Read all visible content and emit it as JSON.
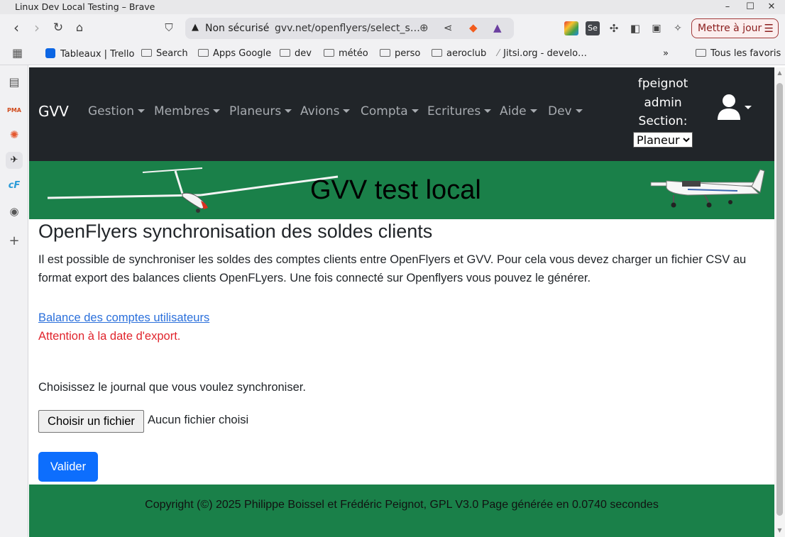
{
  "window": {
    "title": "Linux Dev Local Testing – Brave"
  },
  "browser": {
    "security_label": "Non sécurisé",
    "url": "gvv.net/openflyers/select_s…",
    "update_button": "Mettre à jour"
  },
  "bookmarks": {
    "items": [
      "Tableaux | Trello",
      "Search",
      "Apps Google",
      "dev",
      "météo",
      "perso",
      "aeroclub",
      "Jitsi.org - develo…"
    ],
    "overflow": "»",
    "all_bookmarks": "Tous les favoris"
  },
  "sidebar": {
    "icons": [
      "sidebar-toggle-icon",
      "pma-icon",
      "burst-icon",
      "aircraft-icon",
      "openflyers-icon",
      "globe-icon",
      "plus-icon"
    ]
  },
  "navbar": {
    "brand": "GVV",
    "menus": [
      "Gestion",
      "Membres",
      "Planeurs",
      "Avions",
      "Compta",
      "Ecritures",
      "Aide",
      "Dev"
    ],
    "user": {
      "name": "fpeignot",
      "role": "admin",
      "section_label": "Section:",
      "section_value": "Planeur"
    }
  },
  "banner": {
    "title": "GVV test local"
  },
  "main": {
    "title": "OpenFlyers synchronisation des soldes clients",
    "description": "Il est possible de synchroniser les soldes des comptes clients entre OpenFlyers et GVV. Pour cela vous devez charger un fichier CSV au format export des balances clients OpenFLyers. Une fois connecté sur Openflyers vous pouvez le générer.",
    "link": "Balance des comptes utilisateurs",
    "warning": "Attention à la date d'export.",
    "choose_label": "Choisissez le journal que vous voulez synchroniser.",
    "file_button": "Choisir un fichier",
    "file_status": "Aucun fichier choisi",
    "submit": "Valider"
  },
  "footer": {
    "text": "Copyright (©) 2025 Philippe Boissel et Frédéric Peignot, GPL V3.0 Page générée en 0.0740 secondes"
  },
  "colors": {
    "navbar_bg": "#212529",
    "banner_bg": "#1a8049",
    "link": "#2a6fdb",
    "warning": "#e0252d",
    "primary": "#0d6efd"
  }
}
